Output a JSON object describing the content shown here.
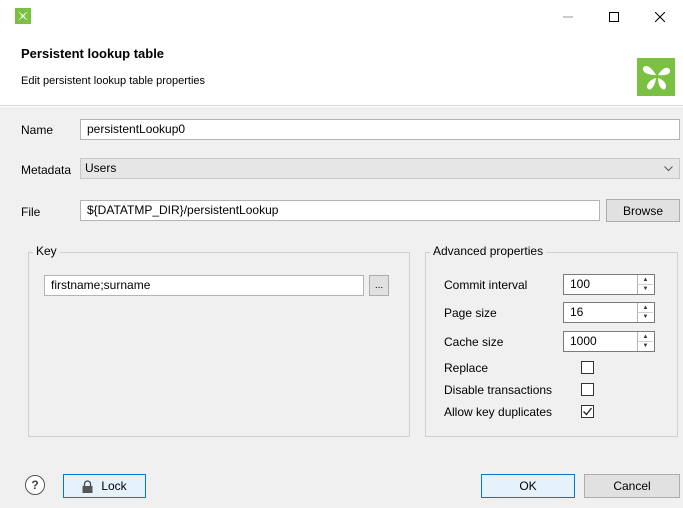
{
  "window": {
    "title": "",
    "minimize_glyph": "—",
    "maximize_glyph": "☐",
    "close_glyph": "✕"
  },
  "dialog": {
    "title": "Persistent lookup table",
    "subtitle": "Edit persistent lookup table properties"
  },
  "form": {
    "name_label": "Name",
    "name_value": "persistentLookup0",
    "metadata_label": "Metadata",
    "metadata_value": "Users",
    "file_label": "File",
    "file_value": "${DATATMP_DIR}/persistentLookup",
    "browse_label": "Browse"
  },
  "key": {
    "group_label": "Key",
    "value": "firstname;surname",
    "ellipsis_label": "..."
  },
  "advanced": {
    "group_label": "Advanced properties",
    "commit_interval_label": "Commit interval",
    "commit_interval_value": "100",
    "page_size_label": "Page size",
    "page_size_value": "16",
    "cache_size_label": "Cache size",
    "cache_size_value": "1000",
    "replace_label": "Replace",
    "replace_checked": false,
    "disable_transactions_label": "Disable transactions",
    "disable_transactions_checked": false,
    "allow_key_duplicates_label": "Allow key duplicates",
    "allow_key_duplicates_checked": true
  },
  "footer": {
    "help_glyph": "?",
    "lock_label": "Lock",
    "ok_label": "OK",
    "cancel_label": "Cancel"
  },
  "colors": {
    "brand_green": "#7ac142",
    "dialog_bg": "#f0f0f0",
    "focus_blue": "#0078d7"
  }
}
